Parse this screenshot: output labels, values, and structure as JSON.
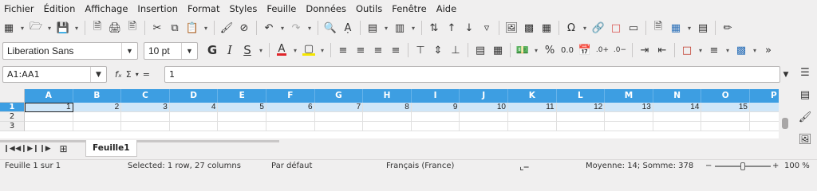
{
  "menu": [
    "Fichier",
    "Édition",
    "Affichage",
    "Insertion",
    "Format",
    "Styles",
    "Feuille",
    "Données",
    "Outils",
    "Fenêtre",
    "Aide"
  ],
  "format_toolbar": {
    "font_name": "Liberation Sans",
    "font_size": "10 pt",
    "bold": "G",
    "italic": "I",
    "underline": "S",
    "font_color_glyph": "A",
    "percent": "%",
    "decimal": "0.0",
    "colors": {
      "font_color": "#e0262b",
      "highlight": "#f5e600",
      "border_color": "#c0392b"
    }
  },
  "formula_bar": {
    "name_box": "A1:AA1",
    "fx": "fₓ",
    "sigma": "Σ",
    "equals": "=",
    "content": "1"
  },
  "grid": {
    "columns": [
      "A",
      "B",
      "C",
      "D",
      "E",
      "F",
      "G",
      "H",
      "I",
      "J",
      "K",
      "L",
      "M",
      "N",
      "O",
      "P"
    ],
    "rows": [
      "1",
      "2",
      "3"
    ],
    "row1_values": [
      "1",
      "2",
      "3",
      "4",
      "5",
      "6",
      "7",
      "8",
      "9",
      "10",
      "11",
      "12",
      "13",
      "14",
      "15"
    ],
    "header_color": "#3d9ee2"
  },
  "sheet": {
    "tab": "Feuille1"
  },
  "status": {
    "sheet": "Feuille 1 sur 1",
    "selection": "Selected: 1 row, 27 columns",
    "style": "Par défaut",
    "language": "Français (France)",
    "summary": "Moyenne: 14; Somme: 378",
    "zoom": "100 %",
    "zoom_level": 1.0
  }
}
